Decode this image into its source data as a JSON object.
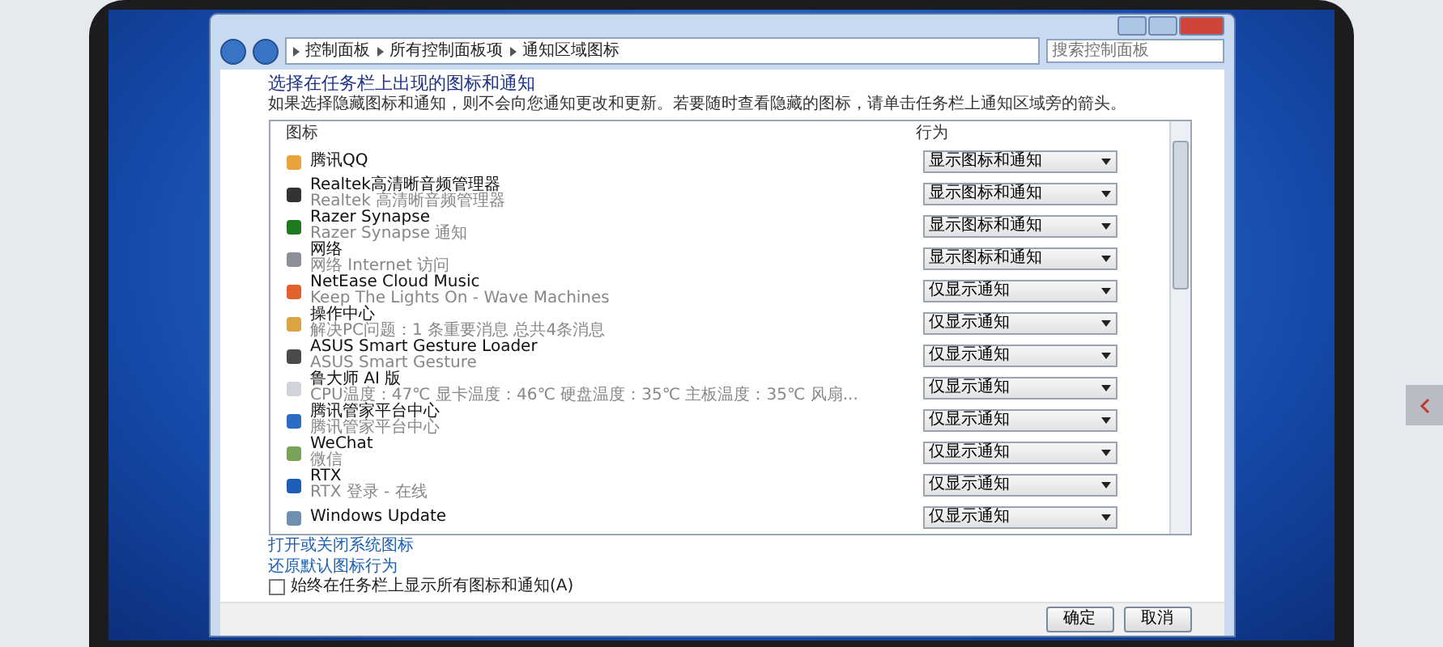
{
  "window": {
    "breadcrumb": [
      "控制面板",
      "所有控制面板项",
      "通知区域图标"
    ],
    "search": {
      "placeholder": "搜索控制面板"
    }
  },
  "heading": "选择在任务栏上出现的图标和通知",
  "description": "如果选择隐藏图标和通知，则不会向您通知更改和更新。若要随时查看隐藏的图标，请单击任务栏上通知区域旁的箭头。",
  "table": {
    "columns": [
      "图标",
      "行为"
    ],
    "rows": [
      {
        "name": "腾讯QQ",
        "color": "#e8a33c",
        "behavior": "显示图标和通知"
      },
      {
        "name": "Realtek高清晰音频管理器",
        "subtitle": "Realtek 高清晰音频管理器",
        "color": "#333333",
        "behavior": "显示图标和通知"
      },
      {
        "name": "Razer Synapse",
        "subtitle": "Razer Synapse 通知",
        "color": "#1f7a1f",
        "behavior": "显示图标和通知"
      },
      {
        "name": "网络",
        "subtitle": "网络 Internet 访问",
        "color": "#8a8f99",
        "behavior": "显示图标和通知"
      },
      {
        "name": "NetEase Cloud Music",
        "subtitle": "Keep The Lights On - Wave Machines",
        "color": "#e0622a",
        "behavior": "仅显示通知"
      },
      {
        "name": "操作中心",
        "subtitle": "解决PC问题：1 条重要消息 总共4条消息",
        "color": "#d9a441",
        "behavior": "仅显示通知"
      },
      {
        "name": "ASUS Smart Gesture Loader",
        "subtitle": "ASUS Smart Gesture",
        "color": "#4a4a4a",
        "behavior": "仅显示通知"
      },
      {
        "name": "鲁大师 AI 版",
        "subtitle": "CPU温度：47℃ 显卡温度：46℃ 硬盘温度：35℃ 主板温度：35℃ 风扇...",
        "color": "#cfd4da",
        "behavior": "仅显示通知"
      },
      {
        "name": "腾讯管家平台中心",
        "subtitle": "腾讯管家平台中心",
        "color": "#2b6cc4",
        "behavior": "仅显示通知"
      },
      {
        "name": "WeChat",
        "subtitle": "微信",
        "color": "#7aa35a",
        "behavior": "仅显示通知"
      },
      {
        "name": "RTX",
        "subtitle": "RTX 登录 - 在线",
        "color": "#1d5fb8",
        "behavior": "仅显示通知"
      },
      {
        "name": "Windows Update",
        "color": "#6f8fb0",
        "behavior": "仅显示通知"
      }
    ]
  },
  "links": [
    "打开或关闭系统图标",
    "还原默认图标行为"
  ],
  "always_show": {
    "label": "始终在任务栏上显示所有图标和通知(A)",
    "checked": false
  },
  "buttons": [
    "确定",
    "取消"
  ]
}
